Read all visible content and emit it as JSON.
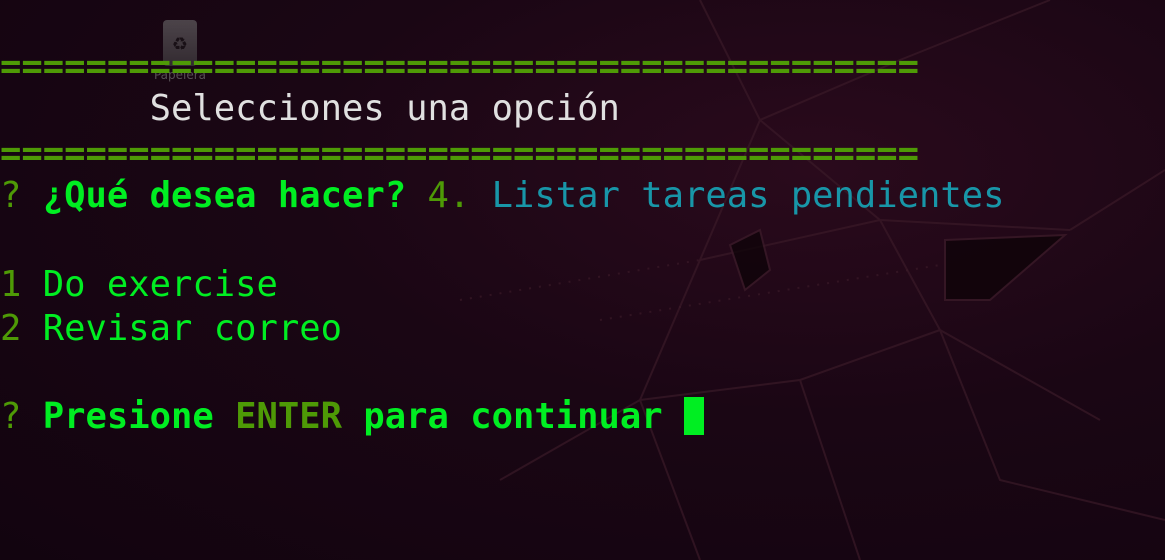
{
  "desktop": {
    "trash_label": "Papelera"
  },
  "terminal": {
    "rule_top": "===========================================",
    "header_title": "       Selecciones una opción",
    "rule_bottom": "===========================================",
    "prompt1": {
      "marker": "?",
      "question": "¿Qué desea hacer?",
      "answer_number": "4.",
      "answer_text": "Listar tareas pendientes"
    },
    "tasks": [
      {
        "number": "1",
        "text": "Do exercise"
      },
      {
        "number": "2",
        "text": "Revisar correo"
      }
    ],
    "prompt2": {
      "marker": "?",
      "text_before": "Presione",
      "key": "ENTER",
      "text_after": "para continuar"
    }
  },
  "colors": {
    "rule": "#4e9a06",
    "bright_green": "#00ee22",
    "answer_cyan": "#1896a8",
    "title_white": "#e0e0e0"
  }
}
